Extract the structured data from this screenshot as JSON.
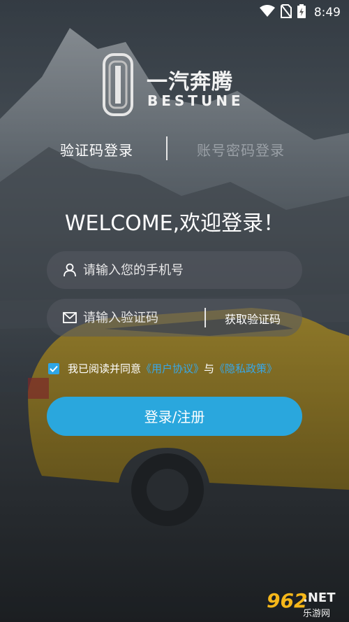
{
  "status_bar": {
    "time": "8:49",
    "icons": [
      "wifi-icon",
      "no-sim-icon",
      "battery-icon"
    ]
  },
  "brand": {
    "name_cn": "一汽奔腾",
    "name_en": "BESTUNE"
  },
  "tabs": [
    {
      "label": "验证码登录",
      "active": true
    },
    {
      "label": "账号密码登录",
      "active": false
    }
  ],
  "welcome": "WELCOME,欢迎登录！",
  "phone_field": {
    "placeholder": "请输入您的手机号",
    "value": ""
  },
  "code_field": {
    "placeholder": "请输入验证码",
    "value": "",
    "get_code_label": "获取验证码"
  },
  "agreement": {
    "checked": true,
    "prefix": "我已阅读并同意",
    "user_agreement": "《用户协议》",
    "conjunction": "与",
    "privacy_policy": "《隐私政策》"
  },
  "login_button": "登录/注册",
  "watermark": {
    "number": "962",
    "net": ".NET",
    "sub": "乐游网"
  },
  "colors": {
    "accent": "#2aa7dd",
    "link": "#38a7e8",
    "watermark_orange": "#f6b71a"
  }
}
